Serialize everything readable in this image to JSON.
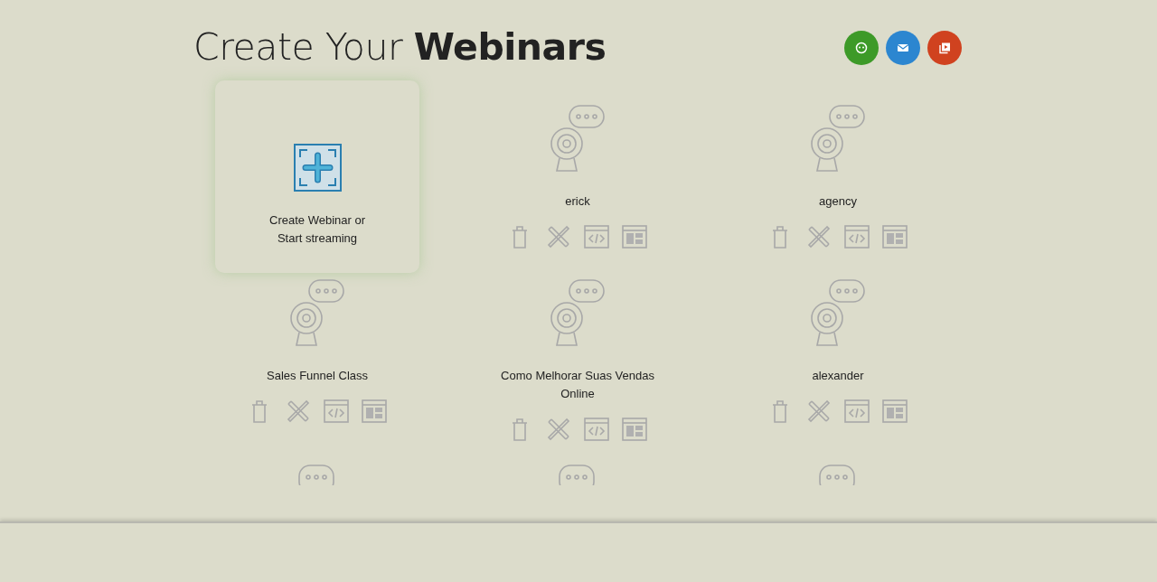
{
  "header": {
    "title": "Create Your **Webinars**",
    "actions": [
      {
        "kind": "chat",
        "color": "#3d9a28"
      },
      {
        "kind": "mail",
        "color": "#2c86d0"
      },
      {
        "kind": "video",
        "color": "#d0421f"
      }
    ]
  },
  "create_card": {
    "label": "Create Webinar or Start streaming"
  },
  "webinars": [
    {
      "kind": "full",
      "name": "erick"
    },
    {
      "kind": "full",
      "name": "agency"
    },
    {
      "kind": "full",
      "name": "Sales Funnel Class"
    },
    {
      "kind": "full",
      "name": "Como Melhorar Suas Vendas Online"
    },
    {
      "kind": "full",
      "name": "alexander"
    },
    {
      "kind": "cut"
    },
    {
      "kind": "cut"
    },
    {
      "kind": "cut"
    }
  ]
}
